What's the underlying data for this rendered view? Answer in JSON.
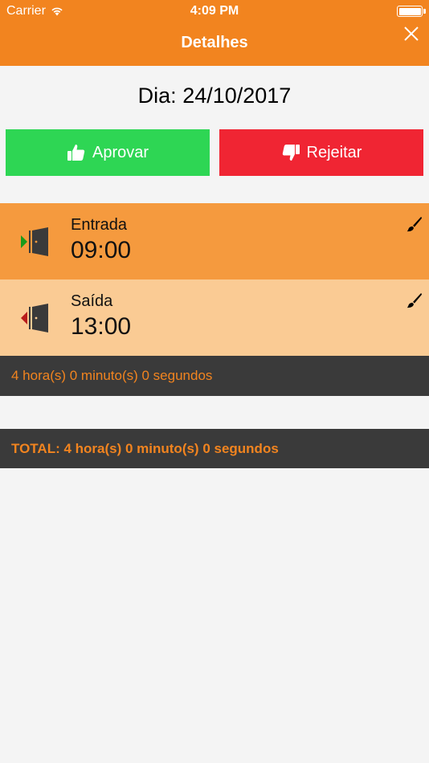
{
  "status_bar": {
    "carrier": "Carrier",
    "time": "4:09 PM"
  },
  "nav": {
    "title": "Detalhes"
  },
  "date": {
    "label": "Dia: 24/10/2017"
  },
  "actions": {
    "approve_label": "Aprovar",
    "reject_label": "Rejeitar"
  },
  "entries": [
    {
      "label": "Entrada",
      "time": "09:00"
    },
    {
      "label": "Saída",
      "time": "13:00"
    }
  ],
  "subtotal": "4 hora(s) 0 minuto(s) 0 segundos",
  "total": "TOTAL: 4 hora(s) 0 minuto(s) 0 segundos",
  "colors": {
    "accent": "#f2841f",
    "approve": "#2ed654",
    "reject": "#f02533",
    "entry_in_bg": "#f59a3e",
    "entry_out_bg": "#facb94",
    "summary_bg": "#3a3a3a"
  }
}
